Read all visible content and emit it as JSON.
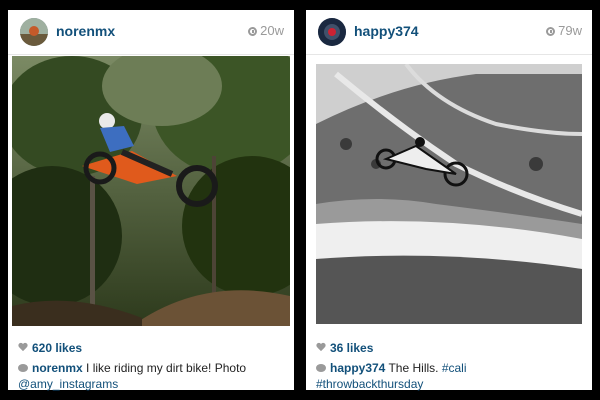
{
  "posts": [
    {
      "username": "norenmx",
      "time": "20w",
      "likes": "620 likes",
      "caption_user": "norenmx",
      "caption_text": " I like riding my dirt bike! Photo ",
      "caption_link": "@amy_instagrams"
    },
    {
      "username": "happy374",
      "time": "79w",
      "likes": "36 likes",
      "caption_user": "happy374",
      "caption_text": " The Hills.  ",
      "caption_link": "#cali",
      "caption_link2": "#throwbackthursday"
    }
  ],
  "colors": {
    "link": "#12507a",
    "muted": "#9a9a9a",
    "background": "#000000"
  }
}
